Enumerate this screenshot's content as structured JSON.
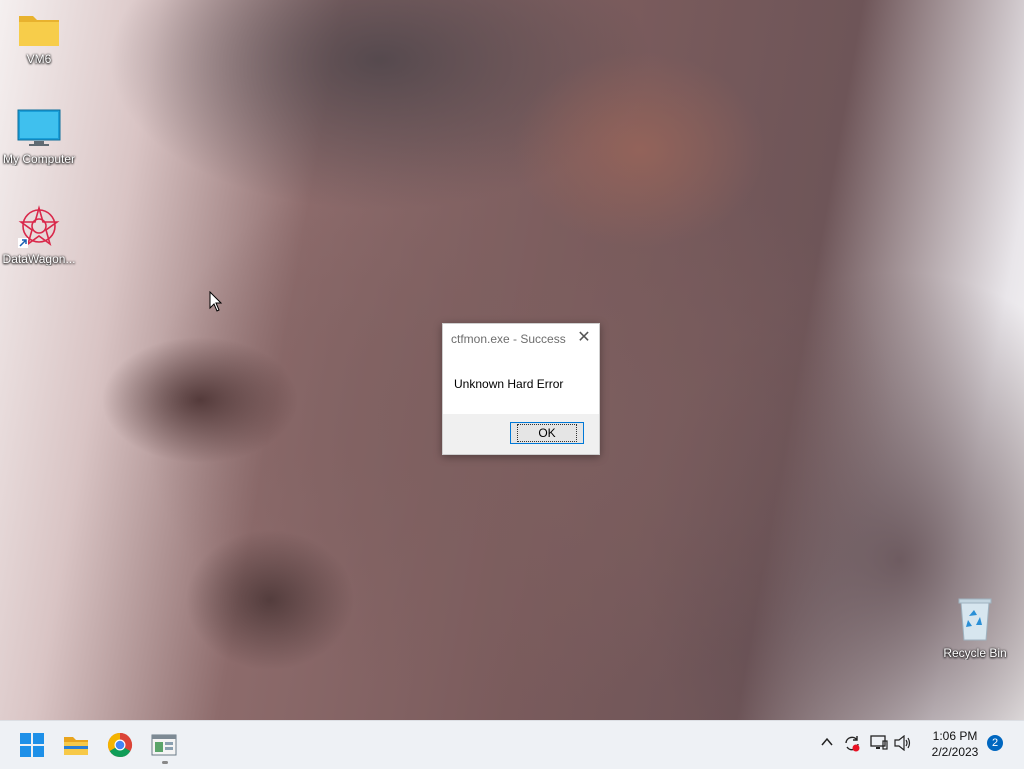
{
  "desktop": {
    "icons": [
      {
        "label": "VM6",
        "icon": "folder-icon"
      },
      {
        "label": "My Computer",
        "icon": "monitor-icon"
      },
      {
        "label": "DataWagon...",
        "icon": "datawagon-app-icon"
      },
      {
        "label": "Recycle Bin",
        "icon": "recycle-bin-icon"
      }
    ]
  },
  "dialog": {
    "title": "ctfmon.exe - Success",
    "message": "Unknown Hard Error",
    "ok_label": "OK",
    "close_icon": "close-icon"
  },
  "taskbar": {
    "apps": [
      {
        "name": "Start",
        "icon": "windows-start-icon"
      },
      {
        "name": "File Explorer",
        "icon": "file-explorer-icon"
      },
      {
        "name": "Google Chrome",
        "icon": "chrome-icon"
      },
      {
        "name": "Running app",
        "icon": "app-window-icon"
      }
    ],
    "tray_icons": [
      "chevron-up-icon",
      "sync-error-icon",
      "network-icon",
      "speaker-icon"
    ],
    "clock": {
      "time": "1:06 PM",
      "date": "2/2/2023"
    },
    "notification_count": "2"
  },
  "colors": {
    "accent": "#0078d7",
    "taskbar_bg": "#eef1f5",
    "badge": "#0067c0"
  }
}
